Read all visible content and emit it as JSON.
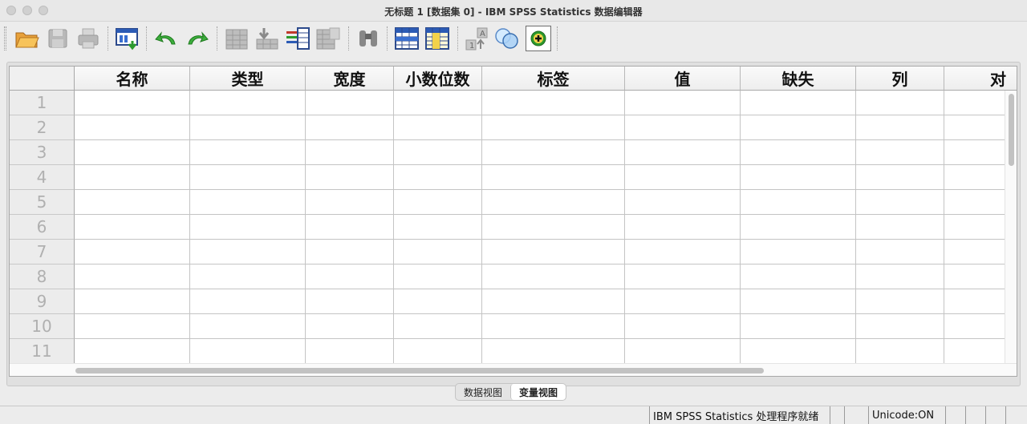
{
  "window": {
    "title": "无标题 1 [数据集 0] - IBM SPSS Statistics 数据编辑器"
  },
  "toolbar": {
    "buttons": [
      "open-icon",
      "save-icon",
      "print-icon",
      "recall-dialog-icon",
      "undo-icon",
      "redo-icon",
      "goto-case-icon",
      "goto-variable-icon",
      "variables-icon",
      "run-descriptives-icon",
      "find-icon",
      "insert-cases-icon",
      "insert-variable-icon",
      "split-file-icon",
      "weight-cases-icon",
      "select-cases-icon",
      "value-labels-icon",
      "use-variable-sets-icon"
    ]
  },
  "grid": {
    "columns": [
      "名称",
      "类型",
      "宽度",
      "小数位数",
      "标签",
      "值",
      "缺失",
      "列",
      "对"
    ],
    "rows": [
      "1",
      "2",
      "3",
      "4",
      "5",
      "6",
      "7",
      "8",
      "9",
      "10",
      "11"
    ]
  },
  "tabs": {
    "data_view": "数据视图",
    "variable_view": "变量视图"
  },
  "status": {
    "processor": "IBM SPSS Statistics 处理程序就绪",
    "unicode": "Unicode:ON"
  }
}
